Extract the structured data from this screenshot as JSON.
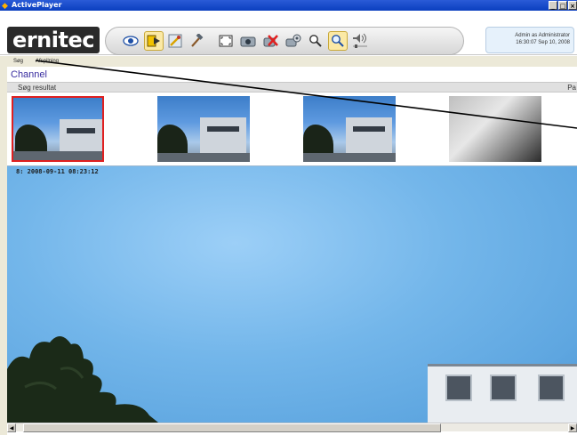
{
  "window": {
    "title": "ActivePlayer",
    "buttons": {
      "minimize": "_",
      "maximize": "□",
      "close": "×"
    }
  },
  "header": {
    "logo_text": "ernitec",
    "user_line": "Admin as Administrator",
    "datetime_line": "16:30:07 Sep 10, 2008"
  },
  "toolbar": {
    "buttons": [
      {
        "name": "live-view",
        "icon": "eye-icon"
      },
      {
        "name": "playback",
        "icon": "play-icon",
        "active": true
      },
      {
        "name": "setup",
        "icon": "wrench-icon"
      },
      {
        "name": "tools",
        "icon": "hammer-icon"
      },
      {
        "name": "fullscreen",
        "icon": "fullscreen-icon"
      },
      {
        "name": "snapshot",
        "icon": "camera-icon"
      },
      {
        "name": "delete",
        "icon": "delete-icon"
      },
      {
        "name": "settings",
        "icon": "gear-icon"
      },
      {
        "name": "search",
        "icon": "search-icon"
      },
      {
        "name": "zoom",
        "icon": "zoom-icon",
        "active": true
      },
      {
        "name": "audio",
        "icon": "speaker-icon"
      }
    ]
  },
  "menu": {
    "items": [
      "Søg",
      "Afspilning"
    ]
  },
  "channel": {
    "label": "Channel"
  },
  "results": {
    "header": "Søg resultat",
    "header_right": "Pa"
  },
  "main_view": {
    "timestamp": "8:  2008-09-11 08:23:12"
  },
  "colors": {
    "accent_selected": "#e02020",
    "channel_label": "#3a2ea0",
    "titlebar": "#0a3fbf"
  }
}
